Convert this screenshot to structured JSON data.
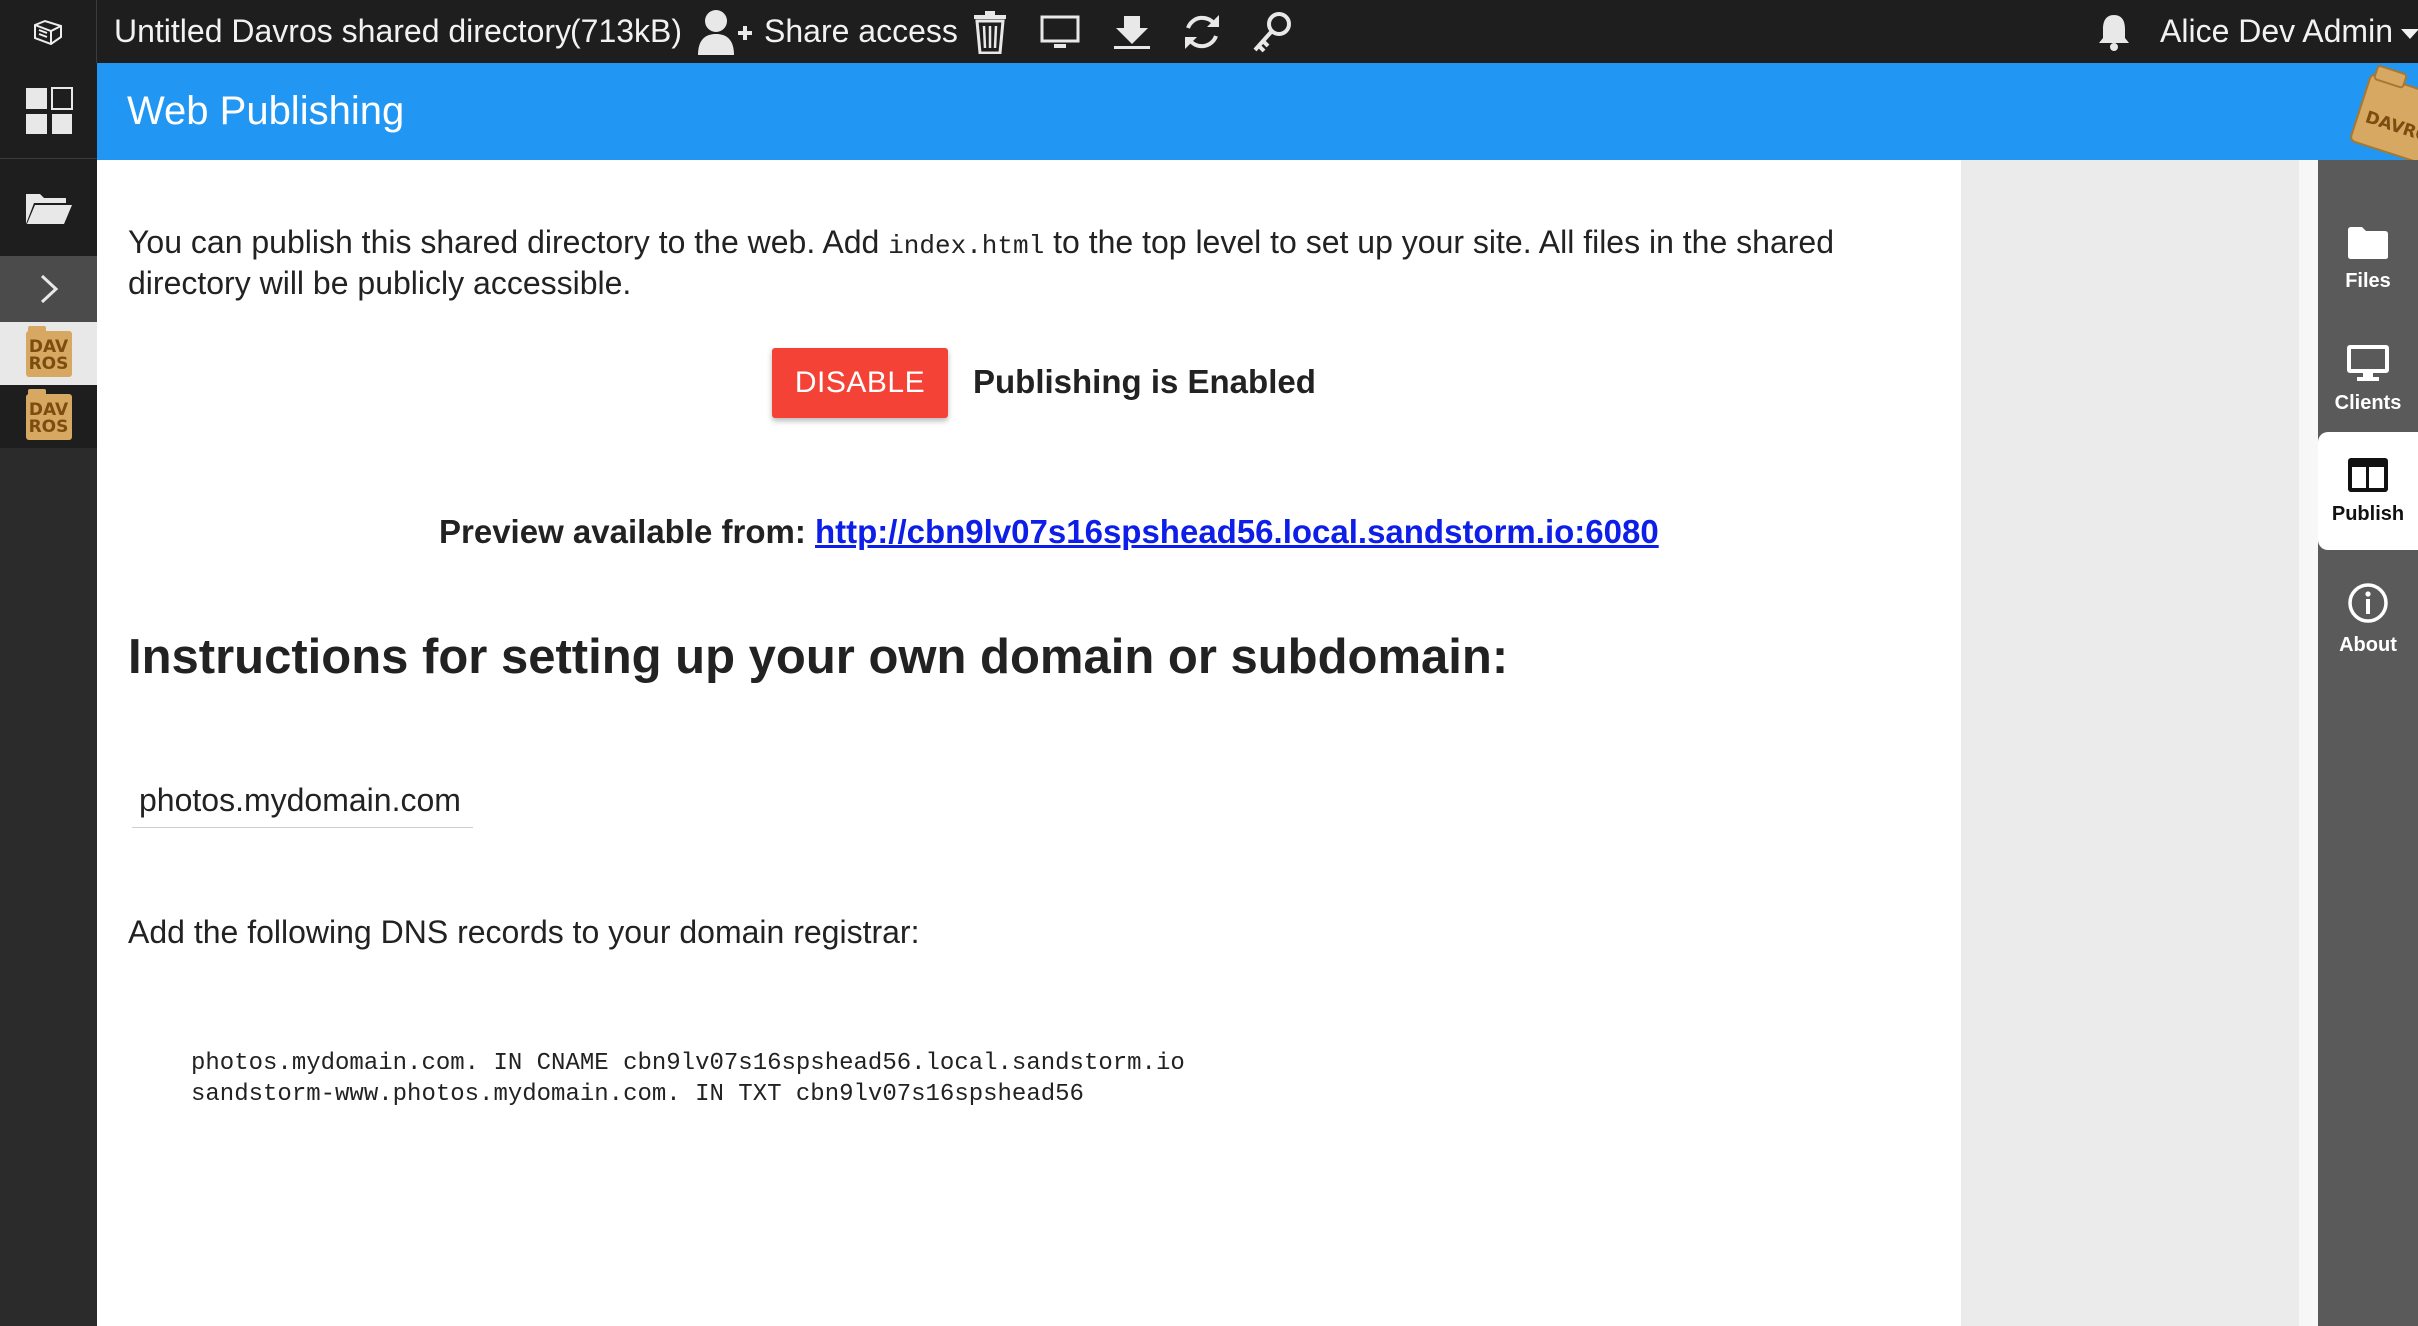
{
  "topbar": {
    "title": "Untitled Davros shared directory",
    "size": "(713kB)",
    "share_label": "Share access",
    "icons": [
      "sandstorm-logo-icon",
      "share-user-icon",
      "trash-icon",
      "monitor-icon",
      "download-icon",
      "refresh-icon",
      "key-icon",
      "bell-icon"
    ],
    "user_name": "Alice Dev Admin"
  },
  "leftbar": {
    "grain_tile_text": [
      "DAV",
      "ROS"
    ]
  },
  "header": {
    "title": "Web Publishing",
    "corner_logo_text": "DAVROS"
  },
  "main": {
    "intro_before": "You can publish this shared directory to the web. Add ",
    "intro_code": "index.html",
    "intro_after": " to the top level to set up your site. All files in the shared directory will be publicly accessible.",
    "disable_label": "DISABLE",
    "status_text": "Publishing is Enabled",
    "preview_label": "Preview available from: ",
    "preview_url": "http://cbn9lv07s16spshead56.local.sandstorm.io:6080",
    "instructions_heading": "Instructions for setting up your own domain or subdomain:",
    "domain_value": "photos.mydomain.com",
    "dns_label": "Add the following DNS records to your domain registrar:",
    "dns_record_1": "photos.mydomain.com. IN CNAME cbn9lv07s16spshead56.local.sandstorm.io",
    "dns_record_2": "sandstorm-www.photos.mydomain.com. IN TXT cbn9lv07s16spshead56"
  },
  "rightnav": {
    "items": [
      {
        "label": "Files",
        "icon": "folder-icon"
      },
      {
        "label": "Clients",
        "icon": "monitor-icon"
      },
      {
        "label": "Publish",
        "icon": "web-layout-icon",
        "active": true
      },
      {
        "label": "About",
        "icon": "info-icon"
      }
    ]
  },
  "colors": {
    "topbar": "#1e1e1e",
    "header": "#2196f3",
    "disable_button": "#f44336",
    "link": "#0d1ee8",
    "rightnav": "#5a5a5a"
  }
}
